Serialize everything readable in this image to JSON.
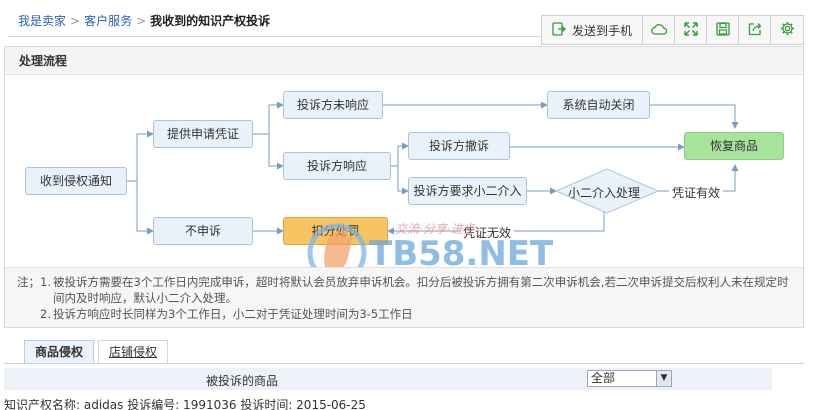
{
  "breadcrumb": {
    "items": [
      "我是卖家",
      "客户服务"
    ],
    "current": "我收到的知识产权投诉"
  },
  "toolbar": {
    "send_label": "发送到手机",
    "icons": [
      "phone-send-icon",
      "cloud-icon",
      "fullscreen-icon",
      "save-icon",
      "share-icon",
      "settings-icon"
    ],
    "icon_color": "#3a9a3a"
  },
  "process": {
    "title": "处理流程",
    "nodes": {
      "receive": "收到侵权通知",
      "provide": "提供申请凭证",
      "no_respond": "投诉方未响应",
      "auto_close": "系统自动关闭",
      "respond": "投诉方响应",
      "withdraw": "投诉方撤诉",
      "restore": "恢复商品",
      "request_xiaoer": "投诉方要求小二介入",
      "xiaoer_process": "小二介入处理",
      "no_appeal": "不申诉",
      "deduct": "扣分处罚"
    },
    "edge_labels": {
      "valid": "凭证有效",
      "invalid": "凭证无效"
    },
    "notes": {
      "prefix": "注；",
      "line1_num": "1.",
      "line1": "被投诉方需要在3个工作日内完成申诉，超时将默认会员放弃申诉机会。扣分后被投诉方拥有第二次申诉机会,若二次申诉提交后权利人未在规定时间内及时响应，默认小二介入处理。",
      "line2_num": "2.",
      "line2": "投诉方响应时长同样为3个工作日，小二对于凭证处理时间为3-5工作日"
    },
    "watermark": {
      "text": "TB58.NET",
      "slogan": "交流·分享·进步"
    },
    "colors": {
      "node_fill": "#e9f2fb",
      "node_border": "#a9c3df",
      "green": "#a8e39b",
      "orange": "#f8c363",
      "arrow": "#7a9cc6"
    }
  },
  "tabs": [
    {
      "label": "商品侵权",
      "active": true
    },
    {
      "label": "店铺侵权",
      "active": false
    }
  ],
  "table": {
    "header_product": "被投诉的商品",
    "filter_value": "全部"
  },
  "record": "知识产权名称: adidas 投诉编号: 1991036 投诉时间: 2015-06-25"
}
